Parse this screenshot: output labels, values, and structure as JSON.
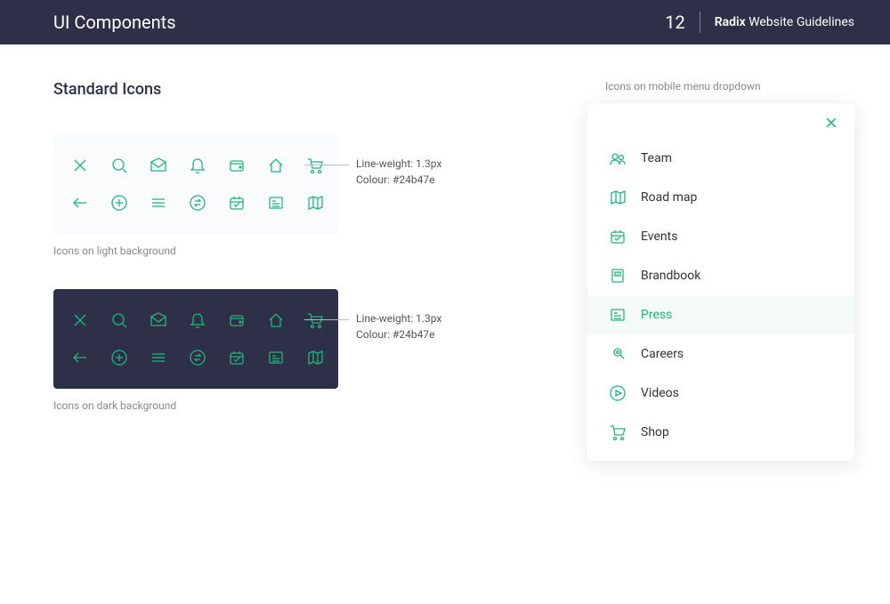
{
  "header": {
    "title": "UI Components",
    "page_number": "12",
    "brand_bold": "Radix",
    "brand_rest": " Website Guidelines"
  },
  "section_title": "Standard Icons",
  "light_panel": {
    "caption": "Icons on light background",
    "annotation_line1": "Line-weight: 1.3px",
    "annotation_line2": "Colour: #24b47e"
  },
  "dark_panel": {
    "caption": "Icons on dark background",
    "annotation_line1": "Line-weight: 1.3px",
    "annotation_line2": "Colour: #24b47e"
  },
  "mobile": {
    "caption": "Icons on mobile menu dropdown",
    "items": [
      {
        "label": "Team"
      },
      {
        "label": "Road map"
      },
      {
        "label": "Events"
      },
      {
        "label": "Brandbook"
      },
      {
        "label": "Press"
      },
      {
        "label": "Careers"
      },
      {
        "label": "Videos"
      },
      {
        "label": "Shop"
      }
    ],
    "active_index": 4
  },
  "colors": {
    "accent": "#24b47e",
    "header_bg": "#2d3047"
  }
}
